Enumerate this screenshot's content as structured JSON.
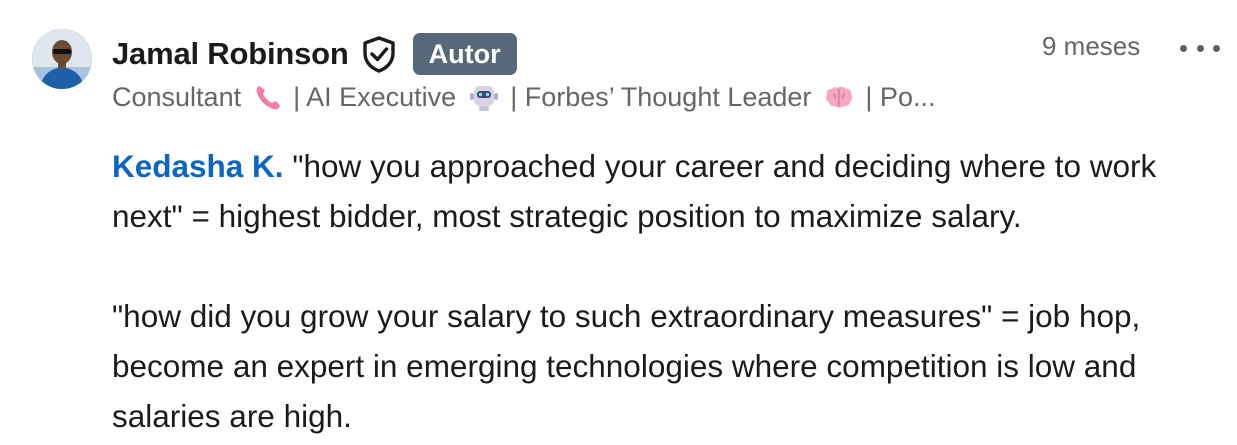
{
  "comment": {
    "author": {
      "name": "Jamal Robinson",
      "badge": "Autor",
      "headline": {
        "segments": [
          {
            "text": "Consultant",
            "emoji": "telephone-receiver-icon"
          },
          {
            "text": "| AI Executive",
            "emoji": "robot-icon"
          },
          {
            "text": "| Forbes’ Thought Leader",
            "emoji": "brain-icon"
          },
          {
            "text": "| Po..."
          }
        ]
      }
    },
    "timestamp": "9 meses",
    "body": {
      "mention": "Kedasha K.",
      "paragraph1": " \"how you approached your career and deciding where to work next\" = highest bidder, most strategic position to maximize salary.",
      "paragraph2": "\"how did you grow your salary to such extraordinary measures\" = job hop, become an expert in emerging technologies where competition is low and salaries are high."
    }
  },
  "colors": {
    "mention": "#0a66c2",
    "badge_bg": "#56687a",
    "secondary_text": "#666666"
  }
}
